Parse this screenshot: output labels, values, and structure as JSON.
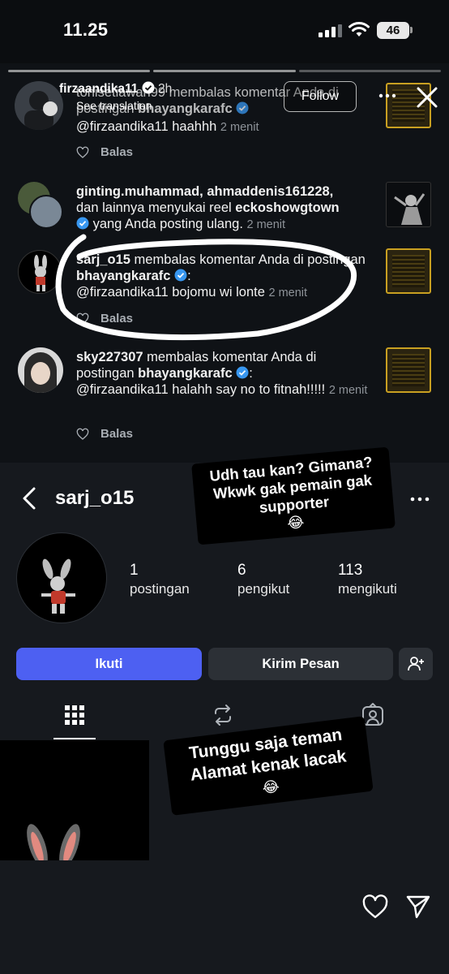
{
  "status_bar": {
    "time": "11.25",
    "battery": "46"
  },
  "story": {
    "user": "firzaandika11",
    "age": "2h",
    "translate": "See translation",
    "follow_label": "Follow"
  },
  "notifications": [
    {
      "prefix": "tonisetiawan99 membalas komentar Anda di postingan ",
      "account": "bhayangkarafc",
      "body": "@firzaandika11 haahhh",
      "time": "2 menit",
      "reply_label": "Balas"
    },
    {
      "users": "ginting.muhammad, ahmaddenis161228,",
      "middle": "dan lainnya menyukai reel ",
      "account": "eckoshowgtown",
      "suffix": " yang Anda posting ulang.",
      "time": "2 menit"
    },
    {
      "user": "sarj_o15",
      "action": " membalas komentar Anda di postingan ",
      "account": "bhayangkarafc",
      "body": "@firzaandika11 bojomu wi lonte",
      "time": "2 menit",
      "reply_label": "Balas"
    },
    {
      "user": "sky227307",
      "action": " membalas komentar Anda di postingan ",
      "account": "bhayangkarafc",
      "body": "@firzaandika11 halahh say no to fitnah!!!!!",
      "time": "2 menit",
      "reply_label": "Balas"
    }
  ],
  "profile": {
    "username": "sarj_o15",
    "stats": [
      {
        "value": "1",
        "label": "postingan"
      },
      {
        "value": "6",
        "label": "pengikut"
      },
      {
        "value": "113",
        "label": "mengikuti"
      }
    ],
    "follow_label": "Ikuti",
    "message_label": "Kirim Pesan",
    "accent": "#4d60f2"
  },
  "stickers": {
    "first_line1": "Udh tau kan? Gimana?",
    "first_line2": "Wkwk gak pemain gak",
    "first_line3": "supporter",
    "second_line1": "Tunggu saja teman",
    "second_line2": "Alamat kenak lacak",
    "emoji": "😂"
  },
  "icons": [
    "close-icon",
    "more-icon",
    "back-arrow-icon",
    "grid-icon",
    "reels-icon",
    "tagged-icon",
    "heart-icon",
    "send-icon",
    "add-user-icon",
    "verified-icon"
  ]
}
